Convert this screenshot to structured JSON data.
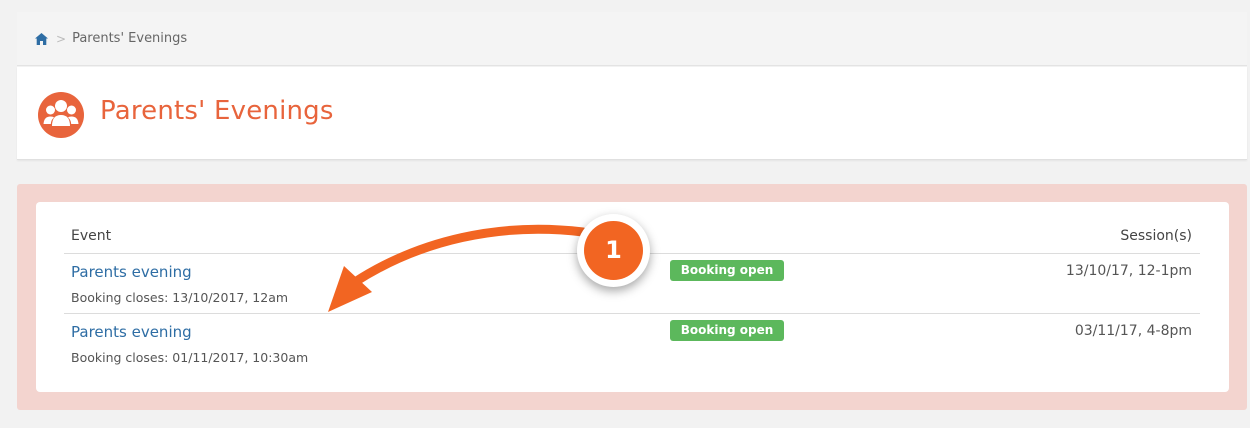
{
  "breadcrumb": {
    "home_icon": "home-icon",
    "separator": ">",
    "current": "Parents' Evenings"
  },
  "header": {
    "icon": "group-icon",
    "title": "Parents' Evenings"
  },
  "table": {
    "columns": {
      "event": "Event",
      "sessions": "Session(s)"
    },
    "rows": [
      {
        "title": "Parents evening",
        "closes": "Booking closes: 13/10/2017, 12am",
        "status": "Booking open",
        "session": "13/10/17, 12-1pm"
      },
      {
        "title": "Parents evening",
        "closes": "Booking closes: 01/11/2017, 10:30am",
        "status": "Booking open",
        "session": "03/11/17, 4-8pm"
      }
    ]
  },
  "annotation": {
    "step_number": "1",
    "arrow_icon": "curved-arrow-icon"
  },
  "colors": {
    "accent": "#e8643c",
    "highlight": "#f3d4cf",
    "badge": "#5cb85c",
    "link": "#2e6da4",
    "step": "#f26522"
  }
}
